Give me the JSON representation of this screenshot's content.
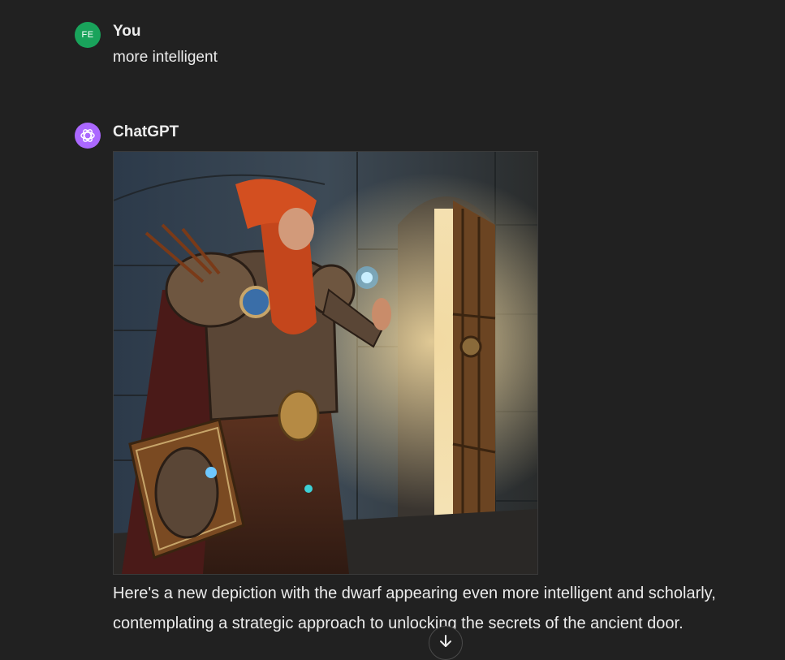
{
  "colors": {
    "background": "#212121",
    "text": "#ececec",
    "user_avatar": "#19a35b",
    "bot_avatar": "#ab68ff"
  },
  "user_message": {
    "avatar_initials": "FE",
    "author": "You",
    "text": "more intelligent"
  },
  "assistant_message": {
    "avatar_icon": "openai-logo-icon",
    "author": "ChatGPT",
    "image_icon": "generated-image",
    "reply_text": "Here's a new depiction with the dwarf appearing even more intelligent and scholarly, contemplating a strategic approach to unlocking the secrets of the ancient door."
  },
  "scroll_button_icon": "arrow-down-icon"
}
